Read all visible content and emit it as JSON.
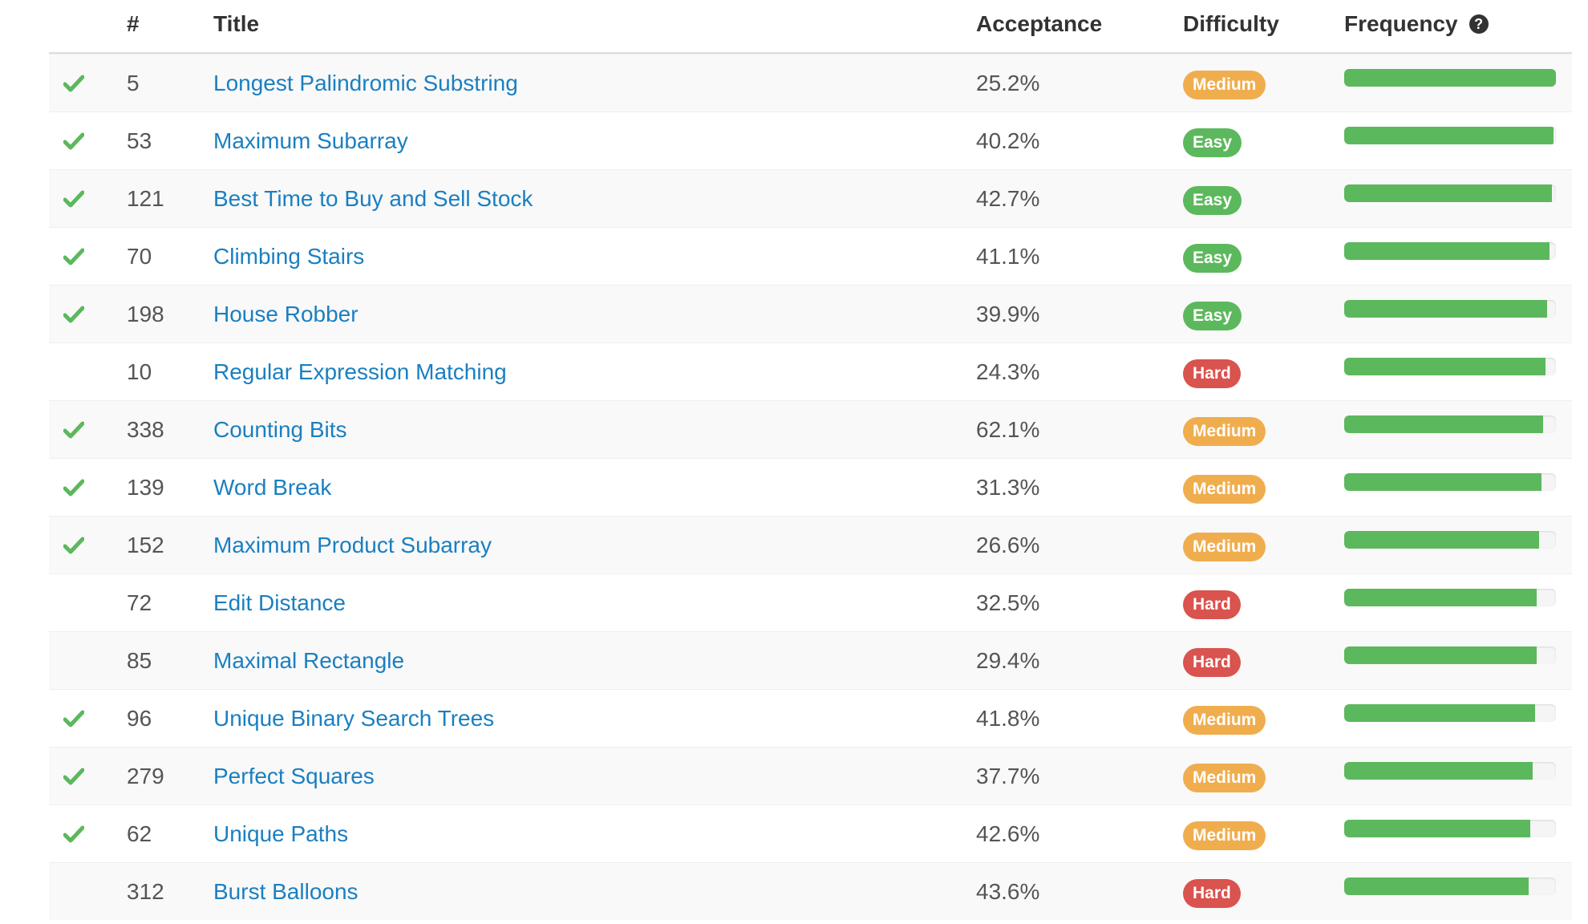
{
  "header": {
    "num": "#",
    "title": "Title",
    "acceptance": "Acceptance",
    "difficulty": "Difficulty",
    "frequency": "Frequency",
    "frequency_help_icon": "question-circle-icon"
  },
  "colors": {
    "Easy": "#5cb85c",
    "Medium": "#f0ad4e",
    "Hard": "#d9534f",
    "check": "#5cb85c",
    "link": "#1a7fc1",
    "frequency_bar": "#5cb85c"
  },
  "rows": [
    {
      "solved": true,
      "num": "5",
      "title": "Longest Palindromic Substring",
      "acceptance": "25.2%",
      "difficulty": "Medium",
      "frequency": 1.0
    },
    {
      "solved": true,
      "num": "53",
      "title": "Maximum Subarray",
      "acceptance": "40.2%",
      "difficulty": "Easy",
      "frequency": 0.99
    },
    {
      "solved": true,
      "num": "121",
      "title": "Best Time to Buy and Sell Stock",
      "acceptance": "42.7%",
      "difficulty": "Easy",
      "frequency": 0.98
    },
    {
      "solved": true,
      "num": "70",
      "title": "Climbing Stairs",
      "acceptance": "41.1%",
      "difficulty": "Easy",
      "frequency": 0.97
    },
    {
      "solved": true,
      "num": "198",
      "title": "House Robber",
      "acceptance": "39.9%",
      "difficulty": "Easy",
      "frequency": 0.96
    },
    {
      "solved": false,
      "num": "10",
      "title": "Regular Expression Matching",
      "acceptance": "24.3%",
      "difficulty": "Hard",
      "frequency": 0.95
    },
    {
      "solved": true,
      "num": "338",
      "title": "Counting Bits",
      "acceptance": "62.1%",
      "difficulty": "Medium",
      "frequency": 0.94
    },
    {
      "solved": true,
      "num": "139",
      "title": "Word Break",
      "acceptance": "31.3%",
      "difficulty": "Medium",
      "frequency": 0.93
    },
    {
      "solved": true,
      "num": "152",
      "title": "Maximum Product Subarray",
      "acceptance": "26.6%",
      "difficulty": "Medium",
      "frequency": 0.92
    },
    {
      "solved": false,
      "num": "72",
      "title": "Edit Distance",
      "acceptance": "32.5%",
      "difficulty": "Hard",
      "frequency": 0.91
    },
    {
      "solved": false,
      "num": "85",
      "title": "Maximal Rectangle",
      "acceptance": "29.4%",
      "difficulty": "Hard",
      "frequency": 0.91
    },
    {
      "solved": true,
      "num": "96",
      "title": "Unique Binary Search Trees",
      "acceptance": "41.8%",
      "difficulty": "Medium",
      "frequency": 0.9
    },
    {
      "solved": true,
      "num": "279",
      "title": "Perfect Squares",
      "acceptance": "37.7%",
      "difficulty": "Medium",
      "frequency": 0.89
    },
    {
      "solved": true,
      "num": "62",
      "title": "Unique Paths",
      "acceptance": "42.6%",
      "difficulty": "Medium",
      "frequency": 0.88
    },
    {
      "solved": false,
      "num": "312",
      "title": "Burst Balloons",
      "acceptance": "43.6%",
      "difficulty": "Hard",
      "frequency": 0.87
    }
  ]
}
